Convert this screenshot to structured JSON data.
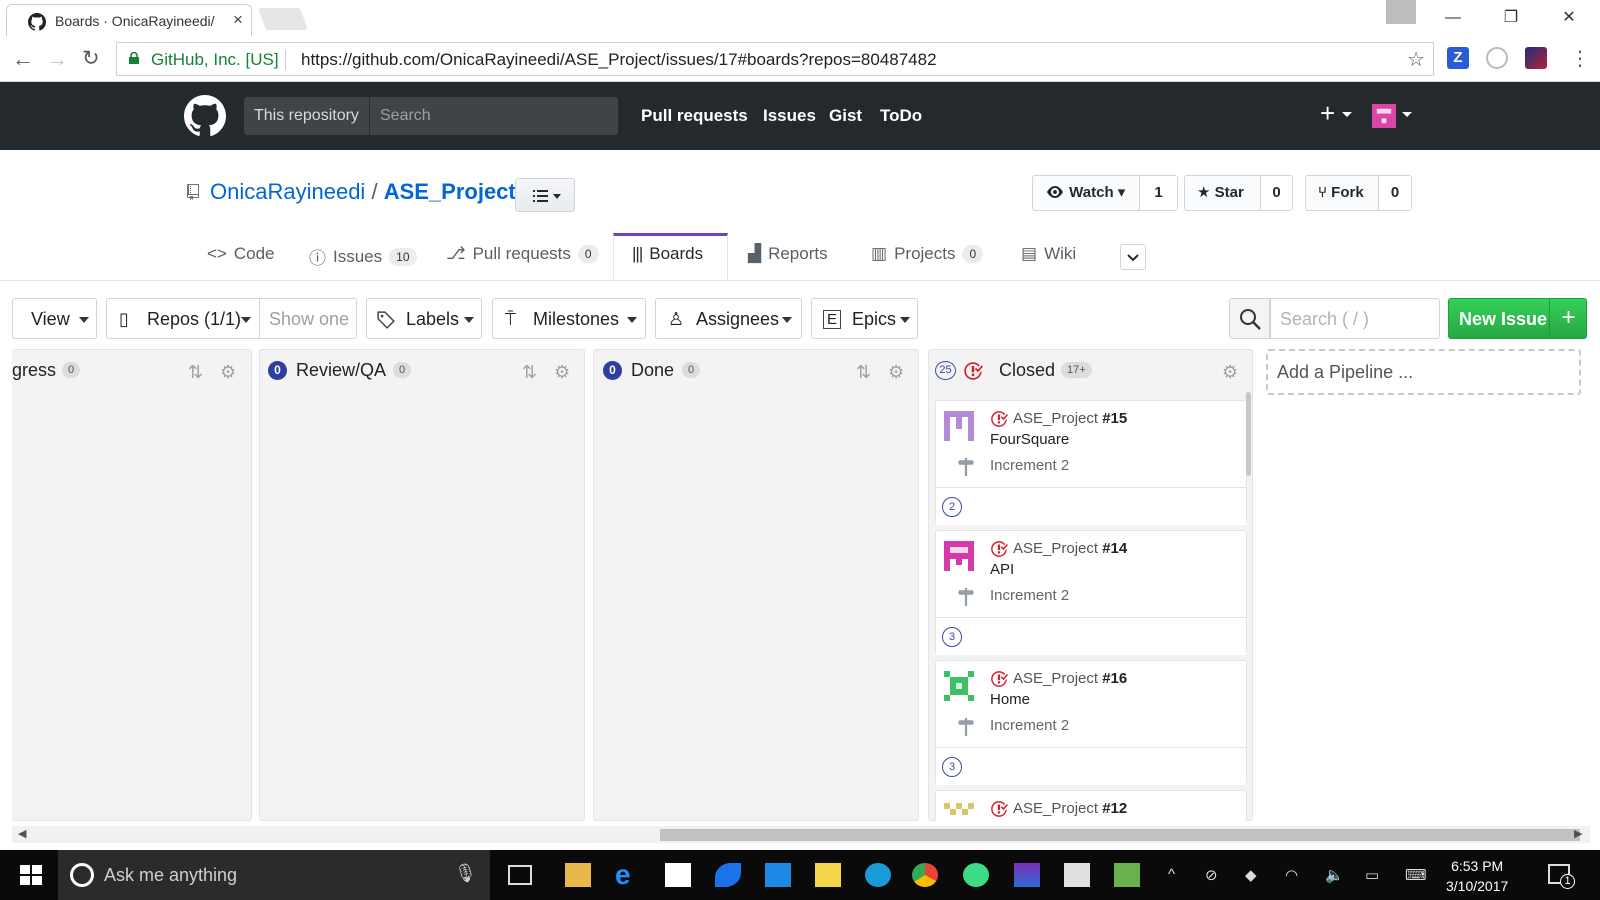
{
  "browser": {
    "tab_title": "Boards · OnicaRayineedi/",
    "tab_close": "×",
    "window_controls": [
      "—",
      "❐",
      "✕"
    ],
    "ev_label": "GitHub, Inc. [US]",
    "url": "https://github.com/OnicaRayineedi/ASE_Project/issues/17#boards?repos=80487482"
  },
  "github_header": {
    "search_scope": "This repository",
    "search_placeholder": "Search",
    "nav": [
      "Pull requests",
      "Issues",
      "Gist",
      "ToDo"
    ],
    "plus": "+"
  },
  "repo": {
    "owner": "OnicaRayineedi",
    "separator": "/",
    "name": "ASE_Project",
    "watch_label": "Watch",
    "watch_count": "1",
    "star_label": "Star",
    "star_count": "0",
    "fork_label": "Fork",
    "fork_count": "0"
  },
  "repo_tabs": [
    {
      "label": "Code",
      "badge": ""
    },
    {
      "label": "Issues",
      "badge": "10"
    },
    {
      "label": "Pull requests",
      "badge": "0"
    },
    {
      "label": "Boards",
      "badge": ""
    },
    {
      "label": "Reports",
      "badge": ""
    },
    {
      "label": "Projects",
      "badge": "0"
    },
    {
      "label": "Wiki",
      "badge": ""
    }
  ],
  "toolbar": {
    "view": "View",
    "repos": "Repos (1/1)",
    "show_one": "Show one",
    "labels": "Labels",
    "milestones": "Milestones",
    "assignees": "Assignees",
    "epics": "Epics",
    "search_placeholder": "Search ( / )",
    "new_issue": "New Issue",
    "new_issue_plus": "+"
  },
  "pipelines": [
    {
      "name": "gress",
      "issue_count": "",
      "count": "0"
    },
    {
      "name": "Review/QA",
      "issue_count": "0",
      "count": "0"
    },
    {
      "name": "Done",
      "issue_count": "0",
      "count": "0"
    },
    {
      "name": "Closed",
      "issue_count": "25",
      "count": "17+"
    }
  ],
  "add_pipeline": "Add a Pipeline ...",
  "cards": [
    {
      "repo": "ASE_Project",
      "number": "#15",
      "title": "FourSquare",
      "milestone": "Increment 2",
      "estimate": "2",
      "avatar_color": "#b48ad8"
    },
    {
      "repo": "ASE_Project",
      "number": "#14",
      "title": "API",
      "milestone": "Increment 2",
      "estimate": "3",
      "avatar_color": "#d63aa8"
    },
    {
      "repo": "ASE_Project",
      "number": "#16",
      "title": "Home",
      "milestone": "Increment 2",
      "estimate": "3",
      "avatar_color": "#3ec166"
    },
    {
      "repo": "ASE_Project",
      "number": "#12",
      "title": "",
      "milestone": "",
      "estimate": "",
      "avatar_color": "#d9c56a"
    }
  ],
  "taskbar": {
    "cortana_placeholder": "Ask me anything",
    "time": "6:53 PM",
    "date": "3/10/2017",
    "notification_count": "1"
  },
  "colors": {
    "closed_icon": "#cb2431",
    "link_blue": "#0366d6",
    "header_dark": "#24292e",
    "green_button": "#28a745",
    "pipeline_badge": "#2f3e9e"
  }
}
